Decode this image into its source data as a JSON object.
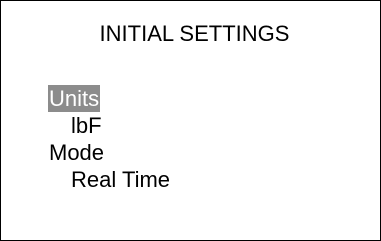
{
  "screen": {
    "title": "INITIAL SETTINGS",
    "selected_color": "#8c8c8c",
    "items": [
      {
        "label": "Units",
        "selected": true
      },
      {
        "value": "lbF"
      },
      {
        "label": "Mode",
        "selected": false
      },
      {
        "value": "Real Time"
      }
    ]
  }
}
